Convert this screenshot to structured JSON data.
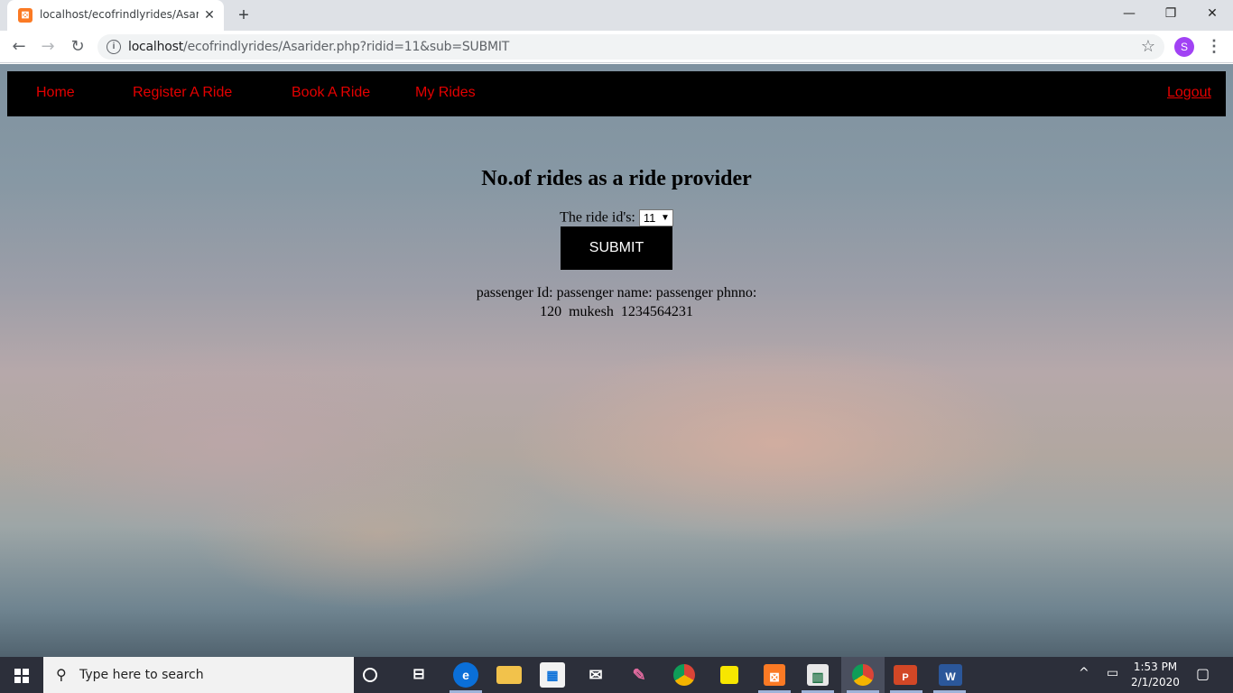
{
  "browser": {
    "tab_title": "localhost/ecofrindlyrides/Asaride",
    "tab_close": "✕",
    "new_tab": "+",
    "url_host": "localhost",
    "url_path": "/ecofrindlyrides/Asarider.php?ridid=11&sub=SUBMIT",
    "profile_initial": "S",
    "window_controls": {
      "minimize": "—",
      "restore": "❐",
      "close": "✕"
    }
  },
  "navbar": {
    "home": "Home",
    "register": "Register A Ride",
    "book": "Book A Ride",
    "my_rides": "My Rides",
    "logout": "Logout",
    "link_color": "#e40000"
  },
  "main": {
    "heading": "No.of rides as a ride provider",
    "ride_id_label": "The ride id's:",
    "ride_id_selected": "11",
    "submit_label": "SUBMIT",
    "result_header": "passenger Id: passenger name: passenger phnno:",
    "result_row": "120  mukesh  1234564231"
  },
  "taskbar": {
    "search_placeholder": "Type here to search",
    "time": "1:53 PM",
    "date": "2/1/2020",
    "pinned_icons": [
      "cortana-icon",
      "task-view-icon",
      "edge-icon",
      "file-explorer-icon",
      "store-icon",
      "mail-icon",
      "paint-icon",
      "chrome-icon",
      "sticky-notes-icon",
      "xampp-icon",
      "chart-app-icon",
      "chrome-profile-icon",
      "powerpoint-icon",
      "word-icon"
    ]
  }
}
